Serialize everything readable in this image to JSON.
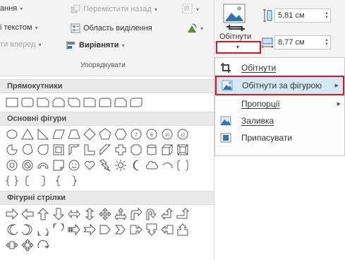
{
  "ribbon": {
    "row1": [
      {
        "label": "ання",
        "enabled": true
      },
      {
        "label": "Перемістити назад",
        "enabled": false
      }
    ],
    "row2": [
      {
        "label": "і текстом",
        "enabled": true
      },
      {
        "label": "Область виділення",
        "enabled": true
      }
    ],
    "row3": [
      {
        "label": "ти вперед",
        "enabled": false
      },
      {
        "label": "Вирівняти",
        "enabled": true
      }
    ],
    "group_label": "Упорядкувати"
  },
  "crop": {
    "label": "Обітнути",
    "height_value": "5,81 см",
    "width_value": "8,77 см"
  },
  "menu": {
    "items": [
      {
        "label": "Обітнути",
        "submenu": false,
        "icon": "crop-icon"
      },
      {
        "label": "Обітнути за фігурою",
        "submenu": true,
        "icon": "crop-to-shape-icon"
      },
      {
        "label": "Пропорції",
        "submenu": true,
        "icon": ""
      },
      {
        "label": "Заливка",
        "submenu": false,
        "icon": "fill-icon"
      },
      {
        "label": "Припасувати",
        "submenu": false,
        "icon": "fit-icon"
      }
    ]
  },
  "gallery": {
    "sections": [
      "Прямокутники",
      "Основні фігури",
      "Фігурні стрілки"
    ]
  },
  "colors": {
    "highlight_red": "#e0141e",
    "menu_hover": "#d5e8f6",
    "ribbon_bg": "#f3f3f3"
  }
}
